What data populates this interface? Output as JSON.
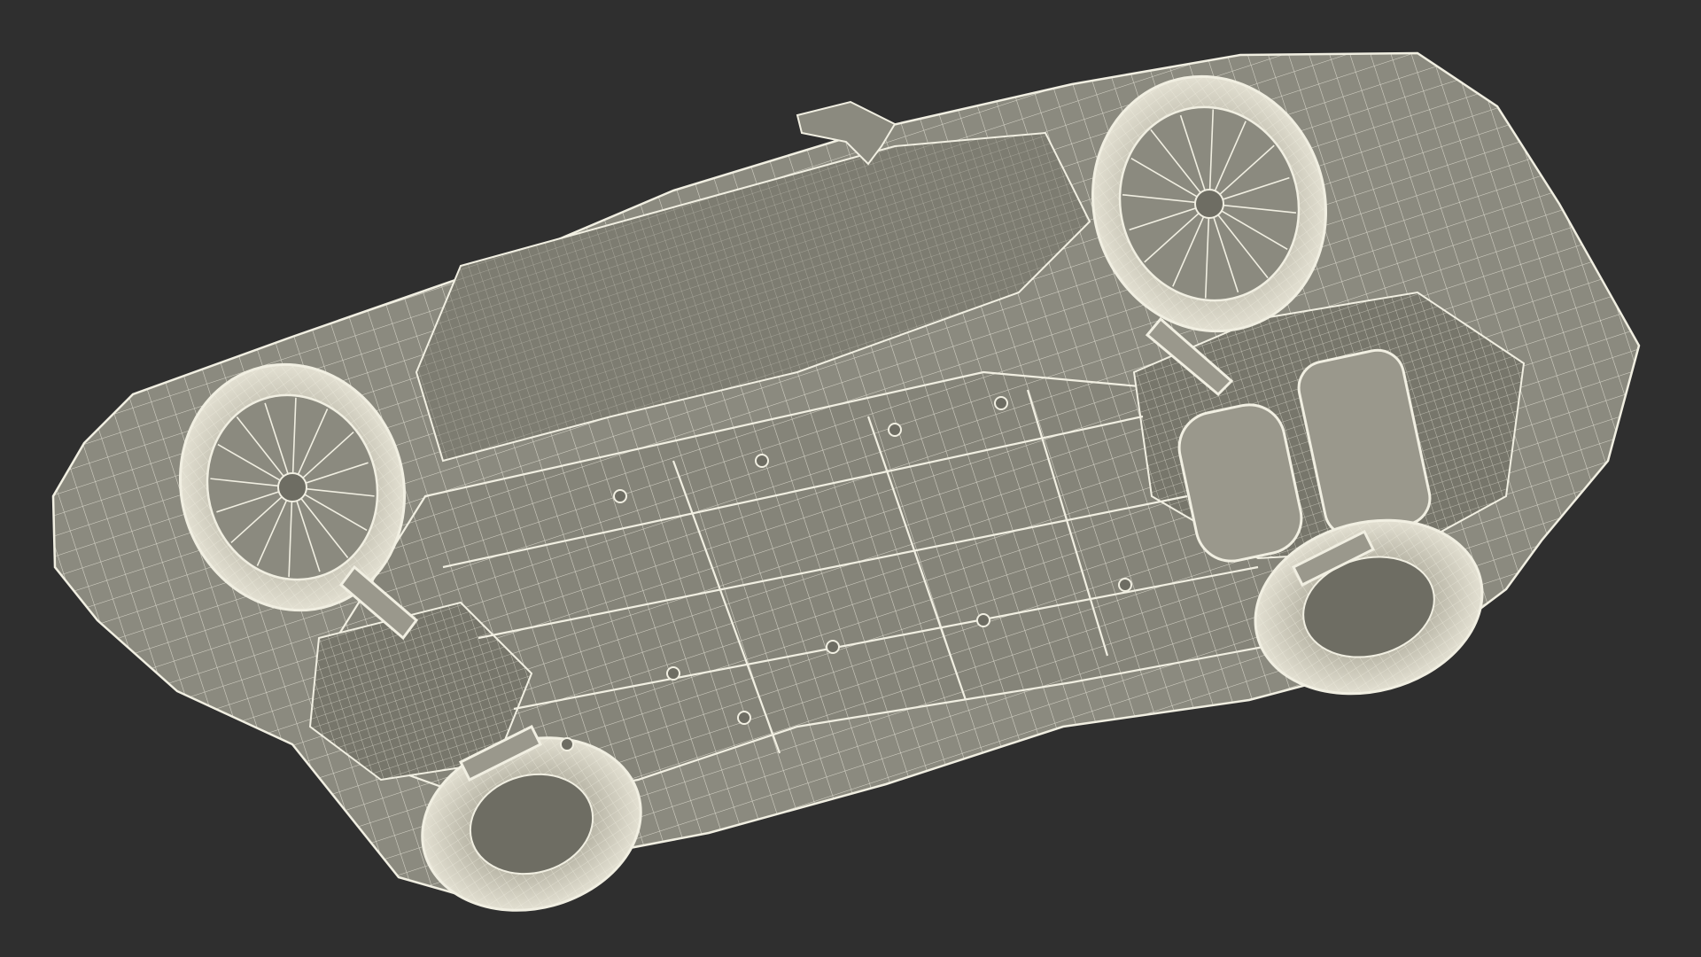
{
  "scene": {
    "subject": "car-underside-wireframe",
    "colors": {
      "background": "#2f2f2f",
      "body_fill": "#8b8a7f",
      "body_shade": "#6e6d63",
      "wire": "#f1efe2",
      "tire_fill": "#cfccbd",
      "dark_detail": "#3c3b35"
    }
  }
}
